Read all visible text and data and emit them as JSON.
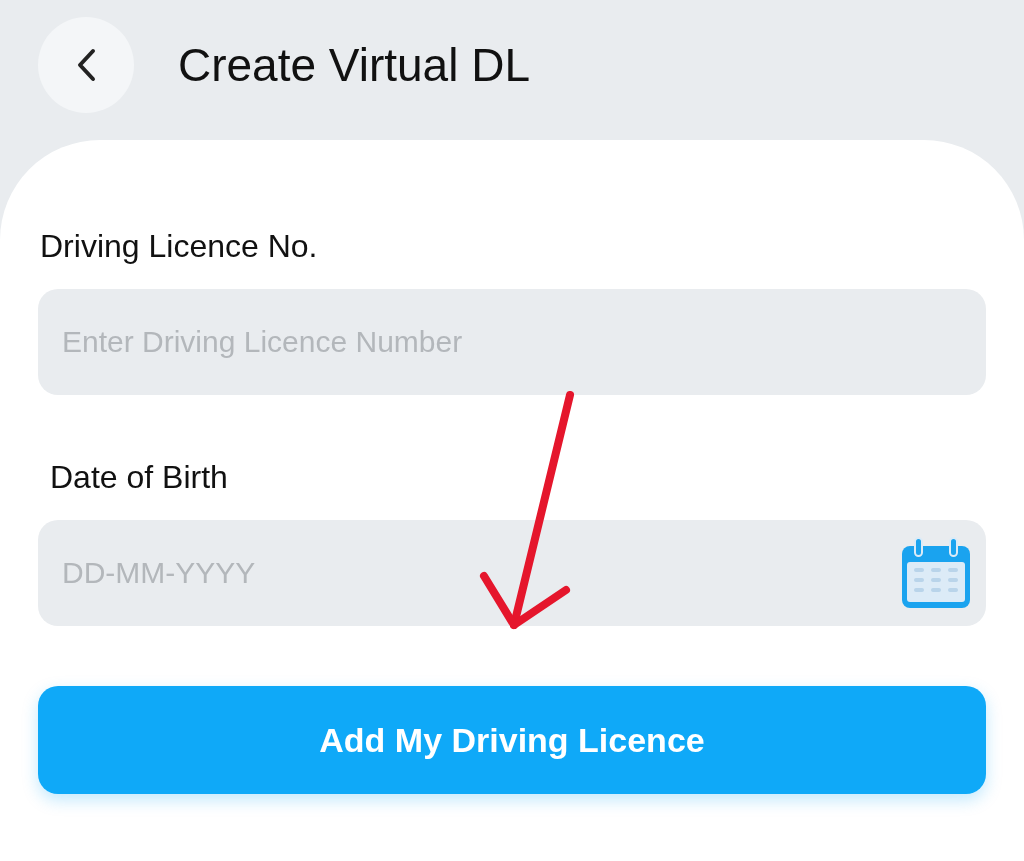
{
  "header": {
    "title": "Create Virtual DL"
  },
  "fields": [
    {
      "kind": "text",
      "label": "Driving Licence No.",
      "placeholder": "Enter Driving Licence Number"
    },
    {
      "kind": "date",
      "label": "Date of Birth",
      "placeholder": "DD-MM-YYYY"
    }
  ],
  "submit_button": {
    "label": "Add My Driving Licence"
  }
}
